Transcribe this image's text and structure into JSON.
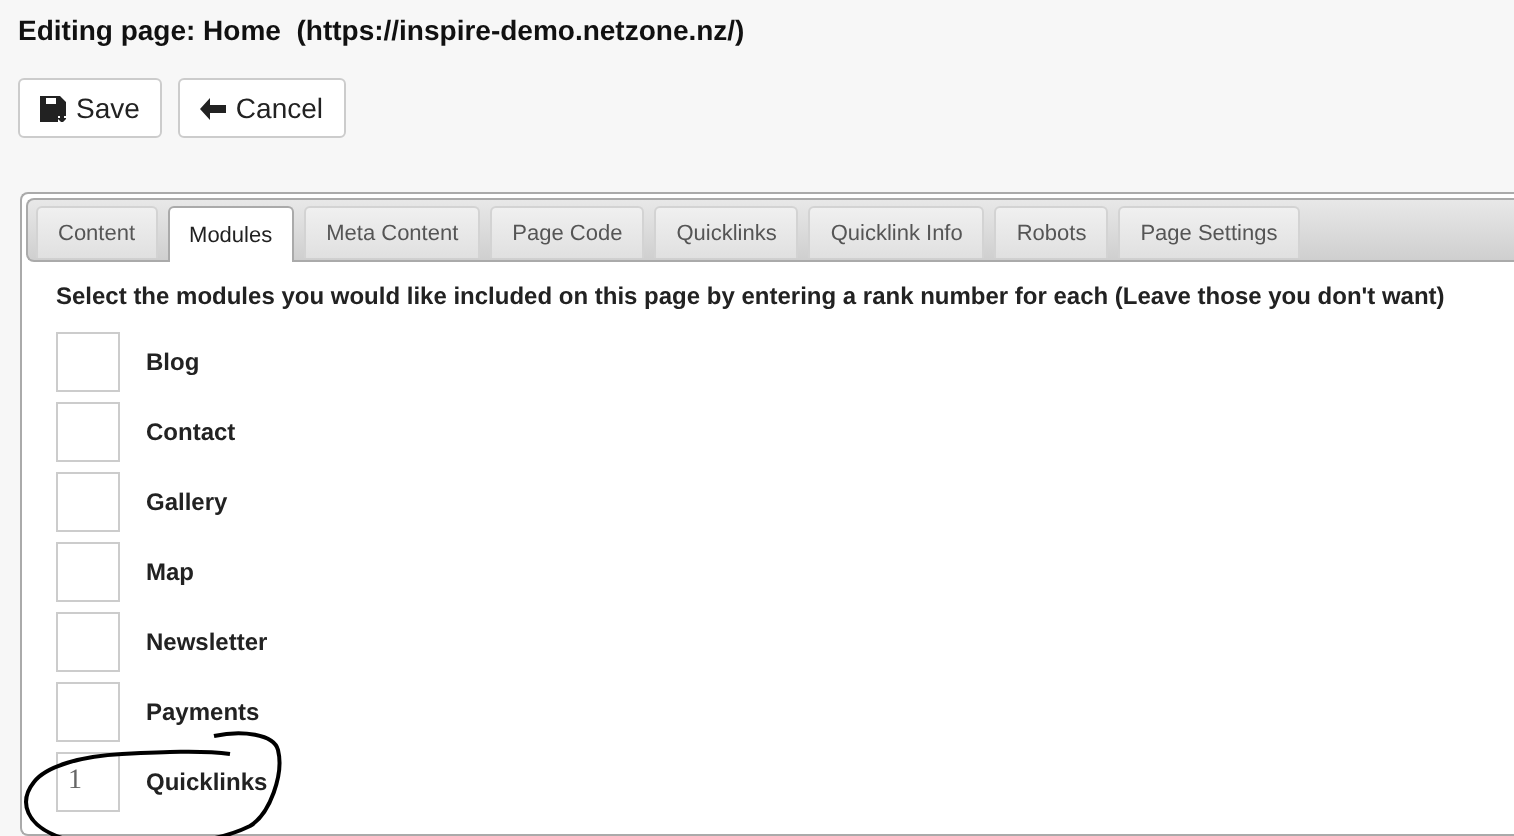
{
  "heading": {
    "label": "Editing page:",
    "page": "Home",
    "url": "(https://inspire-demo.netzone.nz/)"
  },
  "buttons": [
    {
      "kind": "save",
      "label": "Save"
    },
    {
      "kind": "cancel",
      "label": "Cancel"
    }
  ],
  "tabs": [
    {
      "label": "Content",
      "selected": false
    },
    {
      "label": "Modules",
      "selected": true
    },
    {
      "label": "Meta Content",
      "selected": false
    },
    {
      "label": "Page Code",
      "selected": false
    },
    {
      "label": "Quicklinks",
      "selected": false
    },
    {
      "label": "Quicklink Info",
      "selected": false
    },
    {
      "label": "Robots",
      "selected": false
    },
    {
      "label": "Page Settings",
      "selected": false
    }
  ],
  "instructions": "Select the modules you would like included on this page by entering a rank number for each (Leave those you don't want)",
  "modules": [
    {
      "name": "Blog"
    },
    {
      "name": "Contact"
    },
    {
      "name": "Gallery"
    },
    {
      "name": "Map"
    },
    {
      "name": "Newsletter"
    },
    {
      "name": "Payments"
    },
    {
      "name": "Quicklinks",
      "rank": "1",
      "circled": true
    }
  ]
}
